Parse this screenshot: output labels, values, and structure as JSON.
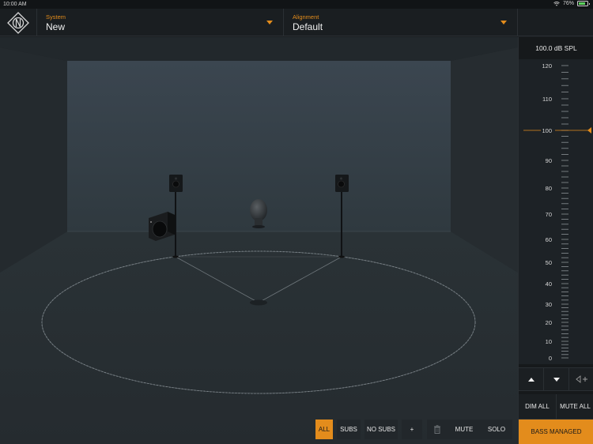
{
  "status_bar": {
    "time": "10:00 AM",
    "battery": "76%",
    "battery_level": 0.76
  },
  "header": {
    "system": {
      "label": "System",
      "value": "New"
    },
    "alignment": {
      "label": "Alignment",
      "value": "Default"
    }
  },
  "meter": {
    "readout": "100.0 dB SPL",
    "ticks": [
      "120",
      "110",
      "100",
      "90",
      "80",
      "70",
      "60",
      "50",
      "40",
      "30",
      "20",
      "10",
      "0"
    ],
    "target_db": 100,
    "accent": "#e38c1c"
  },
  "panel": {
    "up_icon": "arrow-up-icon",
    "down_icon": "arrow-down-icon",
    "add_icon": "add-speaker-icon",
    "dim_all": "DIM ALL",
    "mute_all": "MUTE ALL",
    "bass_managed": "BASS MANAGED"
  },
  "toolbar": {
    "all": "ALL",
    "subs": "SUBS",
    "no_subs": "NO SUBS",
    "add": "+",
    "delete_icon": "trash-icon",
    "mute": "MUTE",
    "solo": "SOLO"
  },
  "colors": {
    "accent": "#e38c1c",
    "background": "#1b1f22"
  }
}
